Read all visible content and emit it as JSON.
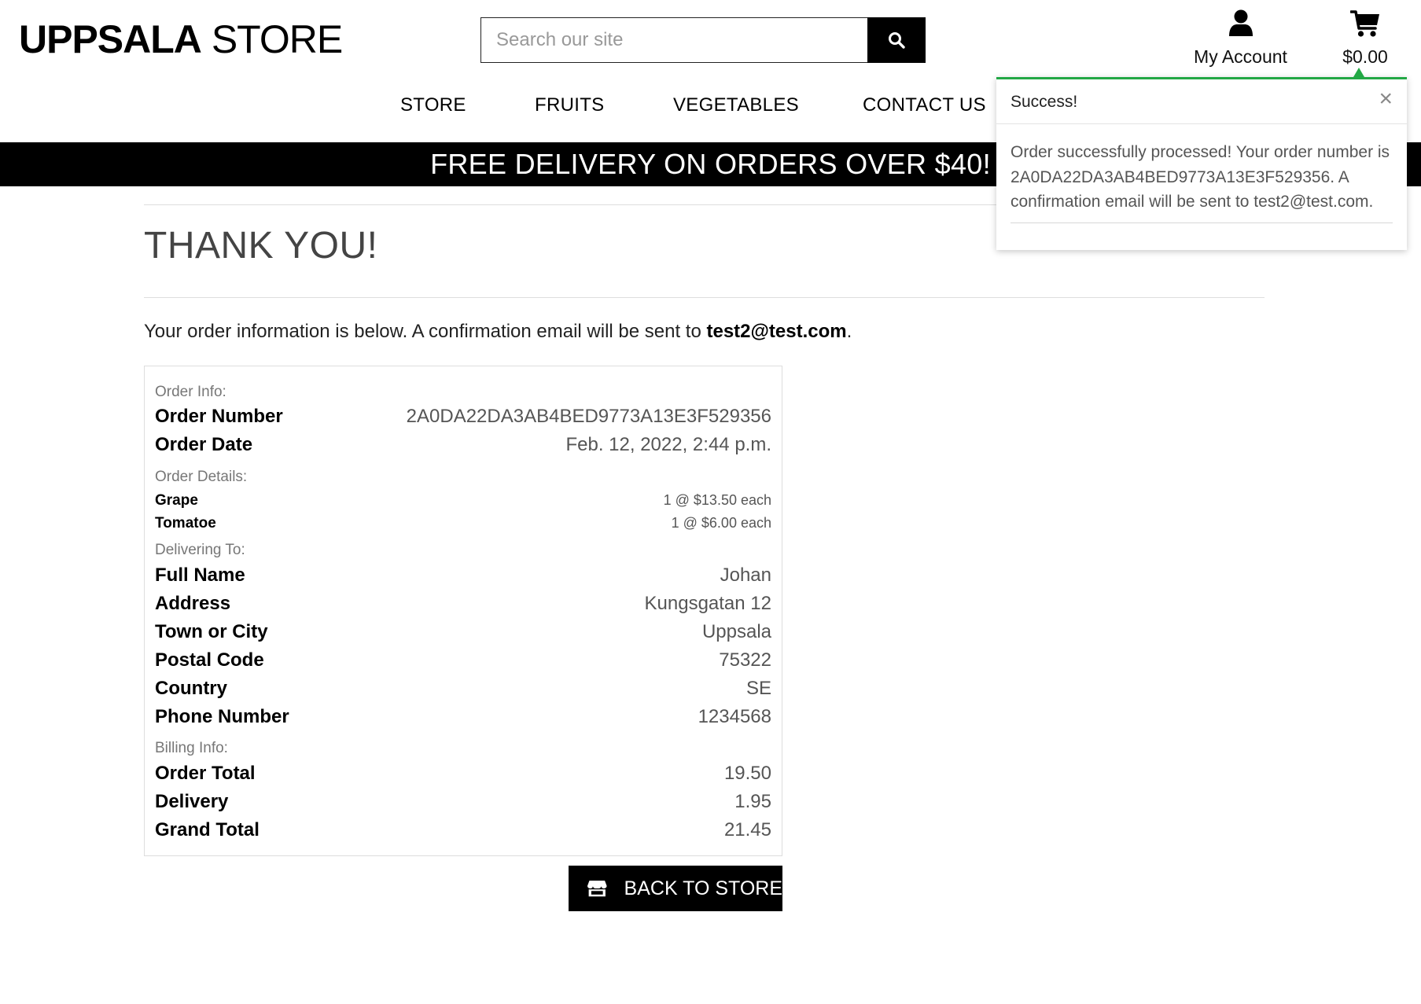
{
  "brand": {
    "bold": "UPPSALA",
    "rest": "STORE"
  },
  "search": {
    "placeholder": "Search our site",
    "icon": "search-icon"
  },
  "account": {
    "label": "My Account",
    "icon": "user-icon"
  },
  "cart": {
    "total": "$0.00",
    "icon": "shopping-cart-icon"
  },
  "nav": {
    "items": [
      "STORE",
      "FRUITS",
      "VEGETABLES",
      "CONTACT US"
    ]
  },
  "banner": {
    "text": "FREE DELIVERY ON ORDERS OVER $40!"
  },
  "toast": {
    "title": "Success!",
    "close": "×",
    "message": "Order successfully processed! Your order number is 2A0DA22DA3AB4BED9773A13E3F529356. A confirmation email will be sent to test2@test.com.",
    "accent_color": "#22a845"
  },
  "page": {
    "title": "THANK YOU!",
    "intro_prefix": "Your order information is below. A confirmation email will be sent to ",
    "email": "test2@test.com",
    "intro_suffix": "."
  },
  "order": {
    "info_heading": "Order Info:",
    "order_number_label": "Order Number",
    "order_number": "2A0DA22DA3AB4BED9773A13E3F529356",
    "order_date_label": "Order Date",
    "order_date": "Feb. 12, 2022, 2:44 p.m.",
    "details_heading": "Order Details:",
    "items": [
      {
        "name": "Grape",
        "qty_price": "1 @ $13.50 each"
      },
      {
        "name": "Tomatoe",
        "qty_price": "1 @ $6.00 each"
      }
    ],
    "delivery_heading": "Delivering To:",
    "delivery": [
      {
        "label": "Full Name",
        "value": "Johan"
      },
      {
        "label": "Address",
        "value": "Kungsgatan 12"
      },
      {
        "label": "Town or City",
        "value": "Uppsala"
      },
      {
        "label": "Postal Code",
        "value": "75322"
      },
      {
        "label": "Country",
        "value": "SE"
      },
      {
        "label": "Phone Number",
        "value": "1234568"
      }
    ],
    "billing_heading": "Billing Info:",
    "billing": [
      {
        "label": "Order Total",
        "value": "19.50"
      },
      {
        "label": "Delivery",
        "value": "1.95"
      },
      {
        "label": "Grand Total",
        "value": "21.45"
      }
    ]
  },
  "back_button": {
    "label": "BACK TO STORE",
    "icon": "store-icon"
  }
}
